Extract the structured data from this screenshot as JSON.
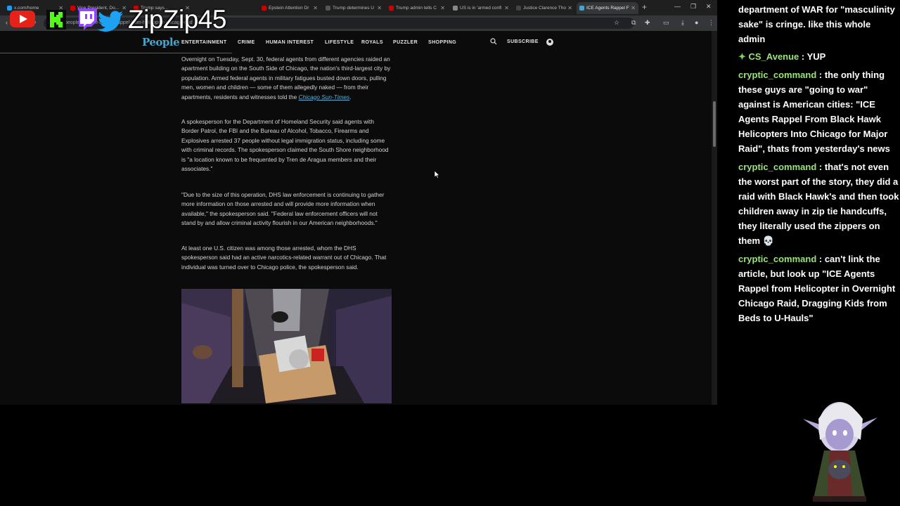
{
  "browser": {
    "tabs": [
      {
        "title": "x.com/home",
        "color": "#1d9bf0"
      },
      {
        "title": "Vice President, Do...",
        "color": "#c00"
      },
      {
        "title": "Trump says...",
        "color": "#c00"
      },
      {
        "title": "Epstein Attention Dr",
        "color": "#c00"
      },
      {
        "title": "Trump determines U",
        "color": "#555"
      },
      {
        "title": "Trump admin tells C",
        "color": "#c00"
      },
      {
        "title": "US is in 'armed confl",
        "color": "#888"
      },
      {
        "title": "Justice Clarence Tho",
        "color": "#444"
      },
      {
        "title": "ICE Agents Rappel F",
        "color": "#4ba3c7"
      }
    ],
    "url": "people.com/ice-agents-rappel-from-helicopter-chicago-raid"
  },
  "site": {
    "logo": "People",
    "nav": [
      "ENTERTAINMENT",
      "CRIME",
      "HUMAN INTEREST",
      "LIFESTYLE",
      "ROYALS",
      "PUZZLER",
      "SHOPPING"
    ],
    "subscribe": "SUBSCRIBE"
  },
  "article": {
    "p1": "Overnight on Tuesday, Sept. 30, federal agents from different agencies raided an apartment building on the South Side of Chicago, the nation's third-largest city by population. Armed federal agents in military fatigues busted down doors, pulling men, women and children — some of them allegedly naked — from their apartments, residents and witnesses told the ",
    "p1_link": "Chicago Sun-Times",
    "p1_end": ".",
    "p2": "A spokesperson for the Department of Homeland Security said agents with Border Patrol, the FBI and the Bureau of Alcohol, Tobacco, Firearms and Explosives arrested 37 people without legal immigration status, including some with criminal records. The spokesperson claimed the South Shore neighborhood is \"a location known to be frequented by Tren de Aragua members and their associates.\"",
    "p3": "\"Due to the size of this operation, DHS law enforcement is continuing to gather more information on those arrested and will provide more information when available,\" the spokesperson said. \"Federal law enforcement officers will not stand by and allow criminal activity flourish in our American neighborhoods.\"",
    "p4": "At least one U.S. citizen was among those arrested, whom the DHS spokesperson said had an active narcotics-related warrant out of Chicago. That individual was turned over to Chicago police, the spokesperson said."
  },
  "overlay": {
    "channel_name": "ZipZip45",
    "icons": [
      "youtube-icon",
      "kick-icon",
      "twitch-icon",
      "twitter-icon"
    ]
  },
  "chat": {
    "messages": [
      {
        "user": "",
        "text": "department of WAR for \"masculinity sake\" is cringe. like this whole admin"
      },
      {
        "user": "CS_Avenue",
        "text": "YUP"
      },
      {
        "user": "cryptic_command",
        "text": "the only thing these guys are \"going to war\" against is American cities: \"ICE Agents Rappel From Black Hawk Helicopters Into Chicago for Major Raid\", thats from yesterday's news"
      },
      {
        "user": "cryptic_command",
        "text": "that's not even the worst part of the story, they did a raid with Black Hawk's and then took children away in zip tie handcuffs, they literally used the zippers on them"
      },
      {
        "user": "cryptic_command",
        "text": "can't link the article, but look up \"ICE Agents Rappel from Helicopter in Overnight Chicago Raid, Dragging Kids from Beds to U-Hauls\""
      }
    ]
  }
}
